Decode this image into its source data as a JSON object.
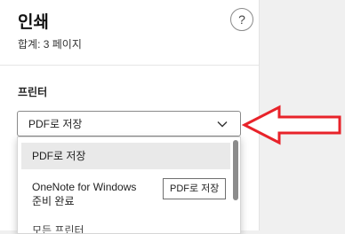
{
  "dialog": {
    "title": "인쇄",
    "subtitle": "합계: 3 페이지",
    "help_icon": "question-mark-icon",
    "help_glyph": "?"
  },
  "printer": {
    "label": "프린터",
    "selected_value": "PDF로 저장",
    "dropdown_icon": "chevron-down-icon",
    "options": [
      {
        "title": "PDF로 저장"
      },
      {
        "title": "OneNote for Windows",
        "subtitle": "준비 완료"
      },
      {
        "title": "모든 프린터"
      }
    ],
    "tooltip": "PDF로 저장"
  },
  "annotation": {
    "icon": "red-left-arrow-icon",
    "color": "#e8232a"
  }
}
